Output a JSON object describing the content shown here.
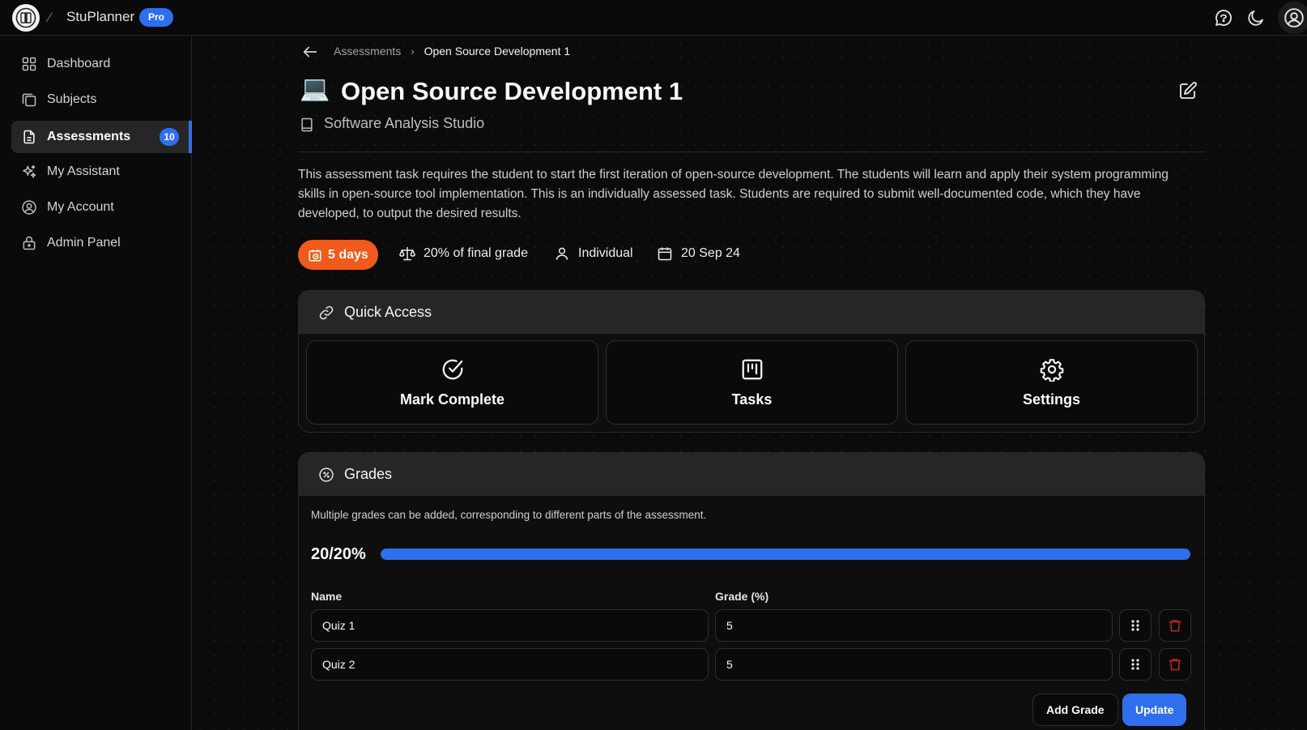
{
  "app": {
    "name": "StuPlanner",
    "plan_badge": "Pro"
  },
  "sidebar": {
    "items": [
      {
        "label": "Dashboard",
        "icon": "grid-icon"
      },
      {
        "label": "Subjects",
        "icon": "layers-icon"
      },
      {
        "label": "Assessments",
        "icon": "document-icon",
        "badge": "10",
        "active": true
      },
      {
        "label": "My Assistant",
        "icon": "sparkles-icon"
      },
      {
        "label": "My Account",
        "icon": "user-circle-icon"
      },
      {
        "label": "Admin Panel",
        "icon": "lock-icon"
      }
    ]
  },
  "breadcrumb": {
    "parent": "Assessments",
    "current": "Open Source Development 1"
  },
  "assessment": {
    "emoji": "💻",
    "title": "Open Source Development 1",
    "subject": "Software Analysis Studio",
    "description": "This assessment task requires the student to start the first iteration of open-source development. The students will learn and apply their system programming skills in open-source tool implementation. This is an individually assessed task. Students are required to submit well-documented code, which they have developed, to output the desired results.",
    "due_in": "5 days",
    "weight": "20% of final grade",
    "type": "Individual",
    "due_date": "20 Sep 24"
  },
  "quick_access": {
    "title": "Quick Access",
    "tiles": [
      {
        "label": "Mark Complete",
        "icon": "check-circle-icon"
      },
      {
        "label": "Tasks",
        "icon": "kanban-icon"
      },
      {
        "label": "Settings",
        "icon": "gear-icon"
      }
    ]
  },
  "grades": {
    "title": "Grades",
    "note": "Multiple grades can be added, corresponding to different parts of the assessment.",
    "progress_label": "20/20%",
    "progress_fraction": 1.0,
    "col_name": "Name",
    "col_grade": "Grade (%)",
    "rows": [
      {
        "name": "Quiz 1",
        "grade": "5"
      },
      {
        "name": "Quiz 2",
        "grade": "5"
      }
    ],
    "add_label": "Add Grade",
    "update_label": "Update"
  },
  "colors": {
    "accent": "#2f6fed",
    "due": "#f05a1a",
    "danger": "#dc2626"
  }
}
